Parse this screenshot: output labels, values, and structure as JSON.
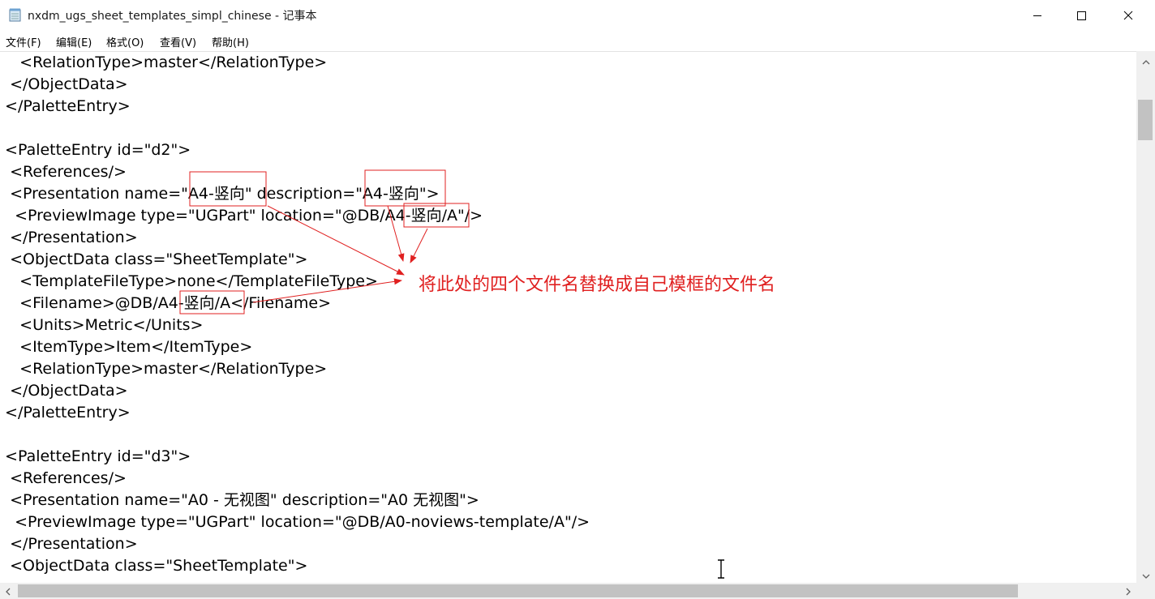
{
  "window": {
    "title": "nxdm_ugs_sheet_templates_simpl_chinese - 记事本",
    "icon": "notepad-icon"
  },
  "controls": {
    "minimize_icon": "minimize-icon",
    "maximize_icon": "maximize-icon",
    "close_icon": "close-icon"
  },
  "menu": {
    "items": [
      {
        "label": "文件(F)"
      },
      {
        "label": "编辑(E)"
      },
      {
        "label": "格式(O)"
      },
      {
        "label": "查看(V)"
      },
      {
        "label": "帮助(H)"
      }
    ]
  },
  "editor": {
    "lines": [
      "    <RelationType>master</RelationType>",
      "  </ObjectData>",
      " </PaletteEntry>",
      "",
      " <PaletteEntry id=\"d2\">",
      "  <References/>",
      "  <Presentation name=\"A4-竖向\" description=\"A4-竖向\">",
      "   <PreviewImage type=\"UGPart\" location=\"@DB/A4-竖向/A\"/>",
      "  </Presentation>",
      "  <ObjectData class=\"SheetTemplate\">",
      "    <TemplateFileType>none</TemplateFileType>",
      "    <Filename>@DB/A4-竖向/A</Filename>",
      "    <Units>Metric</Units>",
      "    <ItemType>Item</ItemType>",
      "    <RelationType>master</RelationType>",
      "  </ObjectData>",
      " </PaletteEntry>",
      "",
      " <PaletteEntry id=\"d3\">",
      "  <References/>",
      "  <Presentation name=\"A0 - 无视图\" description=\"A0 无视图\">",
      "   <PreviewImage type=\"UGPart\" location=\"@DB/A0-noviews-template/A\"/>",
      "  </Presentation>",
      "  <ObjectData class=\"SheetTemplate\">"
    ]
  },
  "annotation": {
    "text": "将此处的四个文件名替换成自己模框的文件名",
    "color": "#e02020"
  },
  "colors": {
    "scrollbar_track": "#f0f0f0",
    "scrollbar_thumb": "#c2c2c2"
  }
}
